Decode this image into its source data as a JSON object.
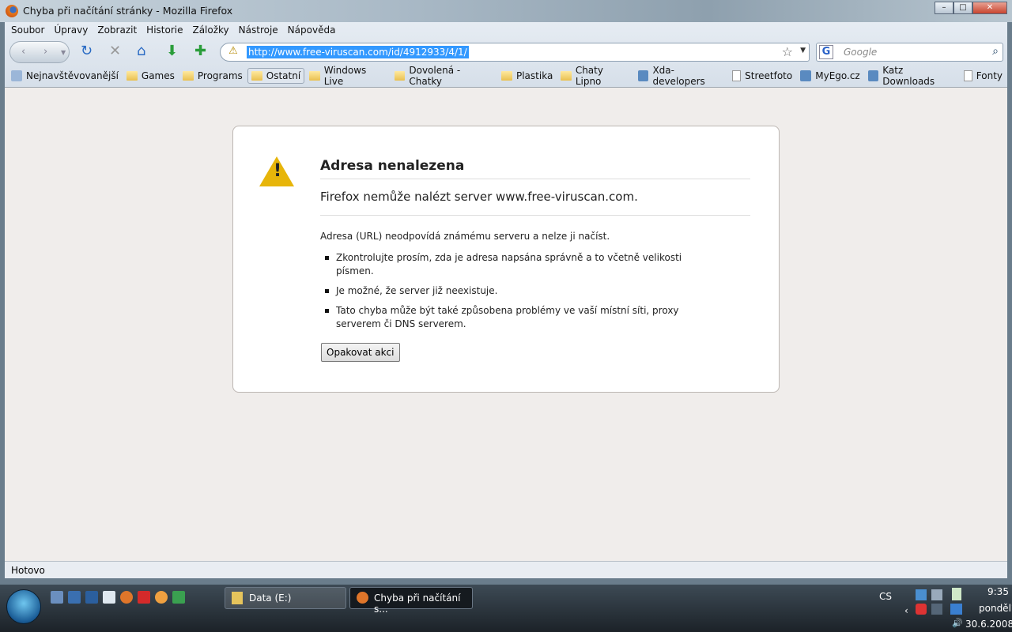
{
  "window": {
    "title": "Chyba při načítání stránky - Mozilla Firefox"
  },
  "menu": [
    "Soubor",
    "Úpravy",
    "Zobrazit",
    "Historie",
    "Záložky",
    "Nástroje",
    "Nápověda"
  ],
  "address": {
    "url": "http://www.free-viruscan.com/id/4912933/4/1/"
  },
  "search": {
    "placeholder": "Google"
  },
  "bookmarks": [
    {
      "label": "Nejnavštěvovanější",
      "icon": "smart-folder"
    },
    {
      "label": "Games",
      "icon": "folder"
    },
    {
      "label": "Programs",
      "icon": "folder"
    },
    {
      "label": "Ostatní",
      "icon": "folder"
    },
    {
      "label": "Windows Live",
      "icon": "folder"
    },
    {
      "label": "Dovolená - Chatky",
      "icon": "folder"
    },
    {
      "label": "Plastika",
      "icon": "folder"
    },
    {
      "label": "Chaty Lipno",
      "icon": "folder"
    },
    {
      "label": "Xda-developers",
      "icon": "site"
    },
    {
      "label": "Streetfoto",
      "icon": "page"
    },
    {
      "label": "MyEgo.cz",
      "icon": "site"
    },
    {
      "label": "Katz Downloads",
      "icon": "site"
    },
    {
      "label": "Fonty",
      "icon": "page"
    }
  ],
  "error": {
    "title": "Adresa nenalezena",
    "short": "Firefox nemůže nalézt server www.free-viruscan.com.",
    "long": "Adresa (URL) neodpovídá známému serveru a nelze ji načíst.",
    "bullets": [
      "Zkontrolujte prosím, zda je adresa napsána správně a to včetně velikosti písmen.",
      "Je možné, že server již neexistuje.",
      "Tato chyba může být také způsobena problémy ve vaší místní síti, proxy serverem či DNS serverem."
    ],
    "retry": "Opakovat akci"
  },
  "status": "Hotovo",
  "taskbar": {
    "tasks": [
      "Data (E:)",
      "Chyba při načítání s..."
    ],
    "lang": "CS",
    "time": "9:35",
    "day": "pondělí",
    "date": "30.6.2008"
  }
}
